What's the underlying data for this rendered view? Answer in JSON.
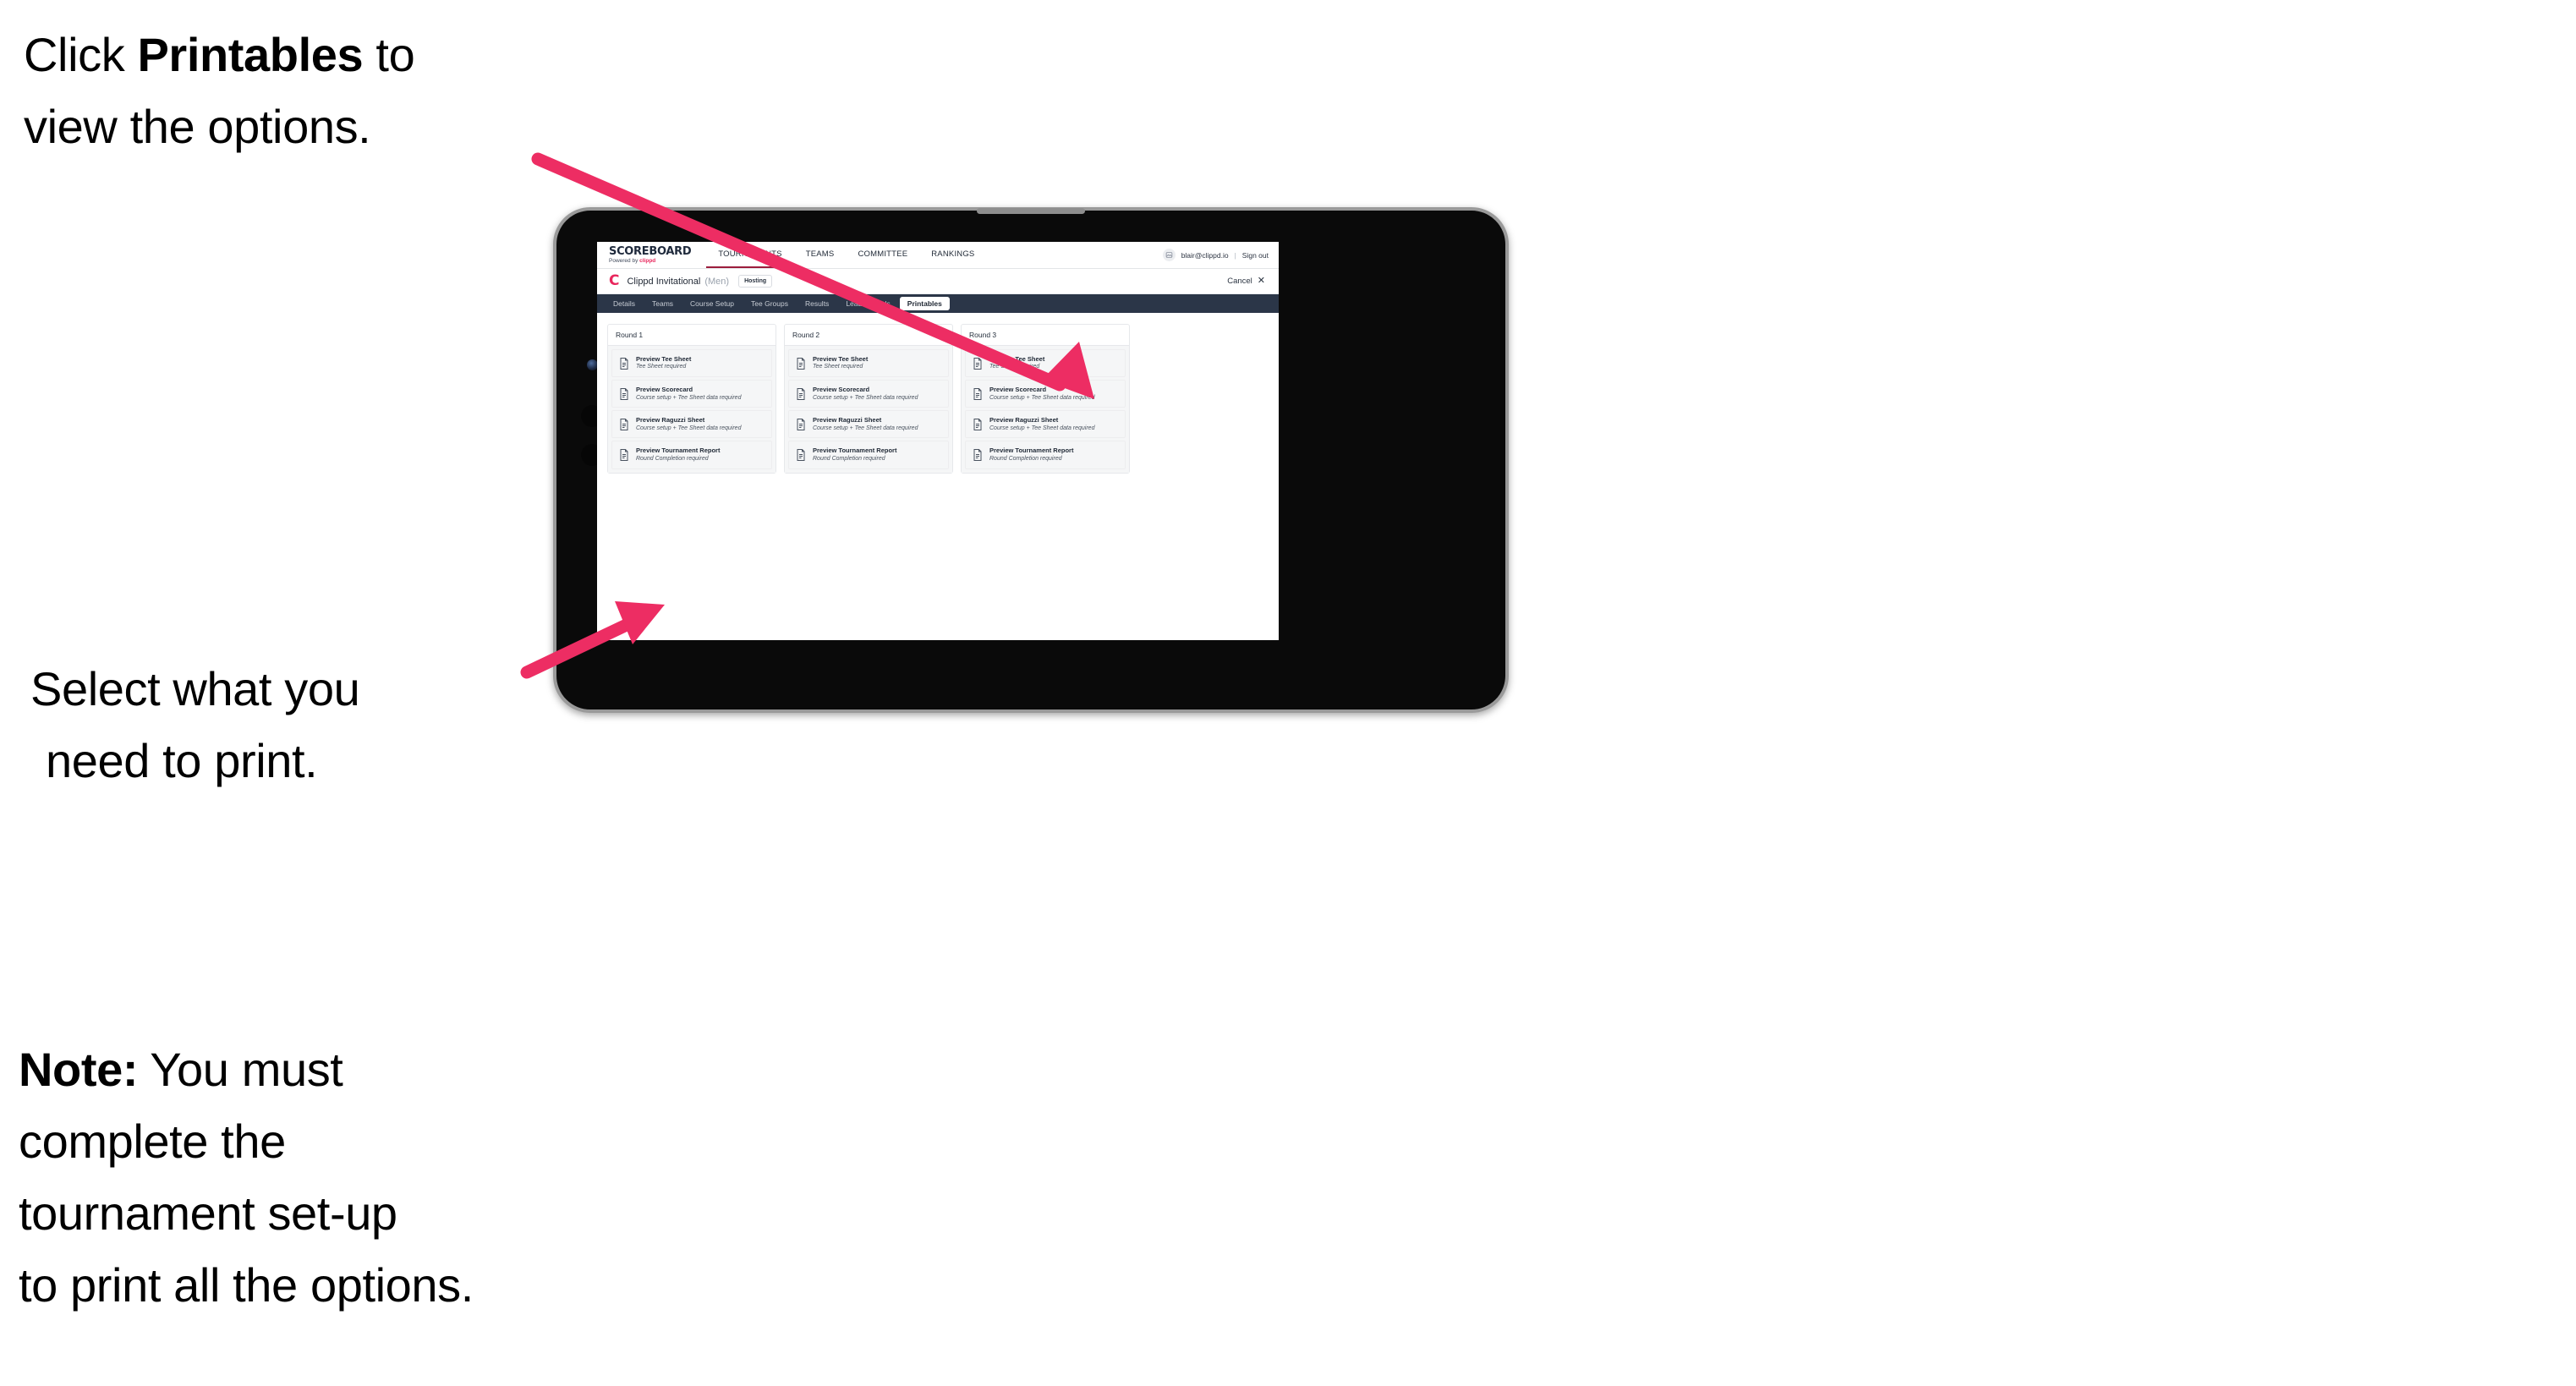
{
  "annotations": {
    "top": {
      "pre": "Click ",
      "bold": "Printables",
      "post": " to",
      "line2": "view the options."
    },
    "middle": {
      "line1": "Select what you",
      "line2": "need to print."
    },
    "note": {
      "label": "Note:",
      "line1_rest": " You must",
      "line2": "complete the",
      "line3": "tournament set-up",
      "line4": "to print all the options."
    }
  },
  "colors": {
    "accent_pink": "#ED2D63",
    "brand_pink": "#E8265C",
    "tabbar_dark": "#2B3648",
    "active_underline": "#9C1D3C"
  },
  "app": {
    "brand": {
      "title": "SCOREBOARD",
      "powered_prefix": "Powered by ",
      "powered_brand": "clippd"
    },
    "topnav": [
      {
        "label": "TOURNAMENTS",
        "active": true
      },
      {
        "label": "TEAMS",
        "active": false
      },
      {
        "label": "COMMITTEE",
        "active": false
      },
      {
        "label": "RANKINGS",
        "active": false
      }
    ],
    "account": {
      "avatar_icon": "user-avatar-icon",
      "email": "blair@clippd.io",
      "separator": "|",
      "sign_out": "Sign out"
    },
    "tournament": {
      "logo_letter": "C",
      "name": "Clippd Invitational",
      "gender": "(Men)",
      "status_badge": "Hosting",
      "cancel_label": "Cancel",
      "cancel_icon": "close-icon"
    },
    "tabs": [
      {
        "label": "Details",
        "active": false
      },
      {
        "label": "Teams",
        "active": false
      },
      {
        "label": "Course Setup",
        "active": false
      },
      {
        "label": "Tee Groups",
        "active": false
      },
      {
        "label": "Results",
        "active": false
      },
      {
        "label": "Leaderboards",
        "active": false
      },
      {
        "label": "Printables",
        "active": true
      }
    ],
    "printables": {
      "rounds": [
        {
          "title": "Round 1",
          "items": [
            {
              "title": "Preview Tee Sheet",
              "requirement": "Tee Sheet required"
            },
            {
              "title": "Preview Scorecard",
              "requirement": "Course setup + Tee Sheet data required"
            },
            {
              "title": "Preview Raguzzi Sheet",
              "requirement": "Course setup + Tee Sheet data required"
            },
            {
              "title": "Preview Tournament Report",
              "requirement": "Round Completion required"
            }
          ]
        },
        {
          "title": "Round 2",
          "items": [
            {
              "title": "Preview Tee Sheet",
              "requirement": "Tee Sheet required"
            },
            {
              "title": "Preview Scorecard",
              "requirement": "Course setup + Tee Sheet data required"
            },
            {
              "title": "Preview Raguzzi Sheet",
              "requirement": "Course setup + Tee Sheet data required"
            },
            {
              "title": "Preview Tournament Report",
              "requirement": "Round Completion required"
            }
          ]
        },
        {
          "title": "Round 3",
          "items": [
            {
              "title": "Preview Tee Sheet",
              "requirement": "Tee Sheet required"
            },
            {
              "title": "Preview Scorecard",
              "requirement": "Course setup + Tee Sheet data required"
            },
            {
              "title": "Preview Raguzzi Sheet",
              "requirement": "Course setup + Tee Sheet data required"
            },
            {
              "title": "Preview Tournament Report",
              "requirement": "Round Completion required"
            }
          ]
        }
      ]
    }
  },
  "device": {
    "type": "tablet",
    "speaker_icon": "speaker-slot-icon",
    "camera_icon": "front-camera-icon",
    "button_icons": [
      "volume-button-icon",
      "power-button-icon"
    ]
  }
}
